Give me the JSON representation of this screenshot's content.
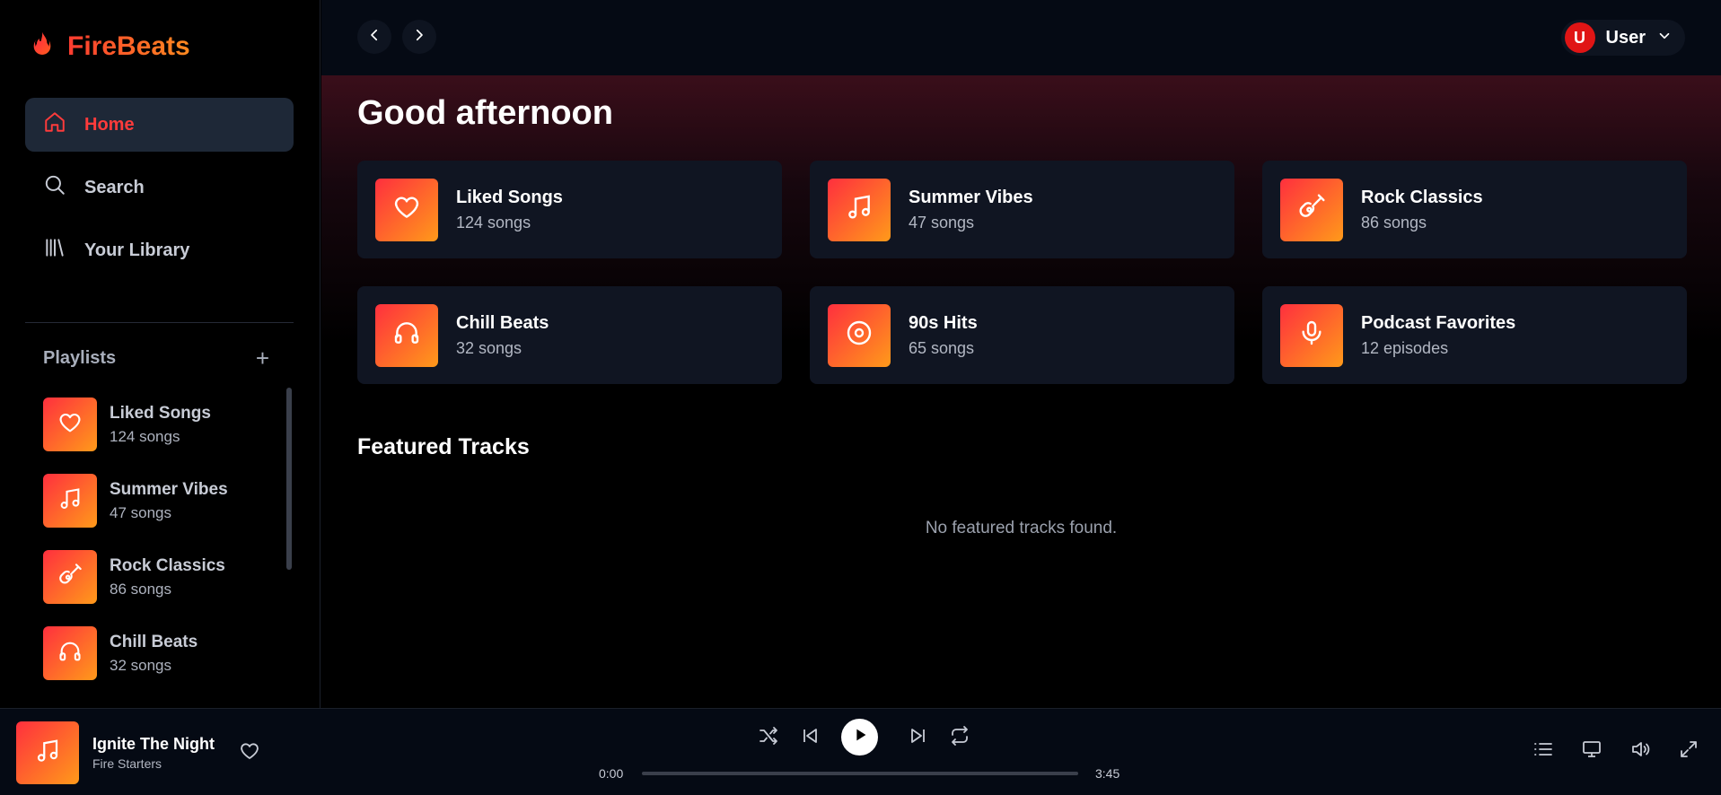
{
  "app": {
    "name": "FireBeats"
  },
  "sidebar": {
    "nav": [
      {
        "label": "Home",
        "icon": "home-icon",
        "active": true
      },
      {
        "label": "Search",
        "icon": "search-icon",
        "active": false
      },
      {
        "label": "Your Library",
        "icon": "library-icon",
        "active": false
      }
    ],
    "playlists_label": "Playlists",
    "add_label": "+",
    "playlists": [
      {
        "name": "Liked Songs",
        "sub": "124 songs",
        "icon": "heart-icon"
      },
      {
        "name": "Summer Vibes",
        "sub": "47 songs",
        "icon": "music-note-icon"
      },
      {
        "name": "Rock Classics",
        "sub": "86 songs",
        "icon": "guitar-icon"
      },
      {
        "name": "Chill Beats",
        "sub": "32 songs",
        "icon": "headphones-icon"
      }
    ]
  },
  "header": {
    "user_initial": "U",
    "user_name": "User"
  },
  "main": {
    "greeting": "Good afternoon",
    "cards": [
      {
        "title": "Liked Songs",
        "sub": "124 songs",
        "icon": "heart-icon"
      },
      {
        "title": "Summer Vibes",
        "sub": "47 songs",
        "icon": "music-note-icon"
      },
      {
        "title": "Rock Classics",
        "sub": "86 songs",
        "icon": "guitar-icon"
      },
      {
        "title": "Chill Beats",
        "sub": "32 songs",
        "icon": "headphones-icon"
      },
      {
        "title": "90s Hits",
        "sub": "65 songs",
        "icon": "disc-icon"
      },
      {
        "title": "Podcast Favorites",
        "sub": "12 episodes",
        "icon": "microphone-icon"
      }
    ],
    "featured_title": "Featured Tracks",
    "featured_empty": "No featured tracks found."
  },
  "player": {
    "title": "Ignite The Night",
    "artist": "Fire Starters",
    "current_time": "0:00",
    "duration": "3:45",
    "progress": 0
  },
  "colors": {
    "accent": "#ff3b3b",
    "gradient_start": "#ff2f3e",
    "gradient_end": "#ff9a1a",
    "card_bg": "#101522",
    "active_nav_bg": "#1e2837"
  }
}
